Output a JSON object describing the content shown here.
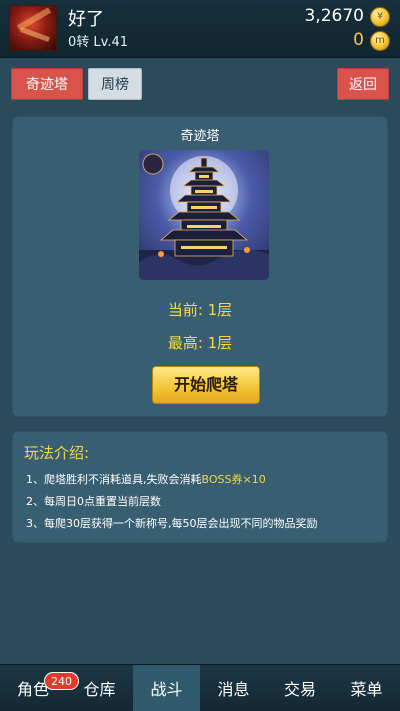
{
  "header": {
    "player_name": "好了",
    "level": "0转 Lv.41",
    "gold": "3,2670",
    "gem": "0",
    "gold_icon": "gold-coin-icon",
    "gem_icon": "gem-coin-icon"
  },
  "top_buttons": {
    "tower": "奇迹塔",
    "weekly": "周榜",
    "back": "返回"
  },
  "tower_panel": {
    "title": "奇迹塔",
    "current": "当前: 1层",
    "max": "最高: 1层",
    "start_button": "开始爬塔"
  },
  "rules": {
    "title": "玩法介绍:",
    "r1_pre": "1、爬塔胜利不消耗道具,失败会消耗",
    "r1_hl": "BOSS券×10",
    "r2": "2、每周日0点重置当前层数",
    "r3": "3、每爬30层获得一个新称号,每50层会出现不同的物品奖励"
  },
  "nav": {
    "items": [
      "角色",
      "仓库",
      "战斗",
      "消息",
      "交易",
      "菜单"
    ],
    "active": "战斗",
    "badge": "240"
  },
  "colors": {
    "accent_yellow": "#f5d84a",
    "button_red": "#d9534c",
    "panel_bg": "#385e71"
  }
}
